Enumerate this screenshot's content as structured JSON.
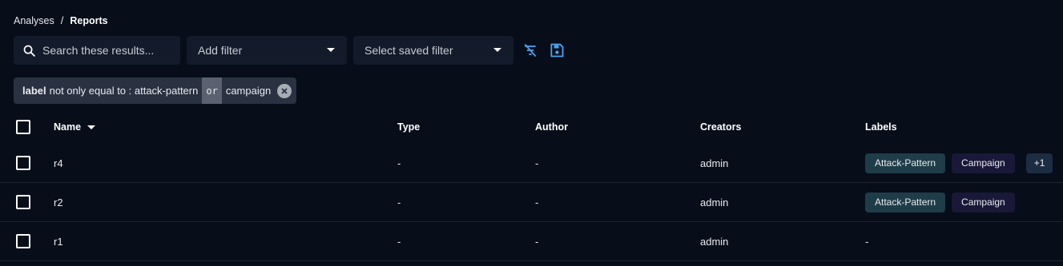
{
  "breadcrumb": {
    "parent": "Analyses",
    "separator": "/",
    "current": "Reports"
  },
  "toolbar": {
    "search_placeholder": "Search these results...",
    "add_filter": "Add filter",
    "saved_filter": "Select saved filter"
  },
  "active_filter": {
    "key": "label",
    "operator_and_value": "not only equal to : attack-pattern",
    "conjunction": "or",
    "value2": "campaign"
  },
  "table": {
    "columns": [
      "Name",
      "Type",
      "Author",
      "Creators",
      "Labels"
    ],
    "rows": [
      {
        "name": "r4",
        "type": "-",
        "author": "-",
        "creators": "admin",
        "labels": [
          "Attack-Pattern",
          "Campaign"
        ],
        "more": "+1"
      },
      {
        "name": "r2",
        "type": "-",
        "author": "-",
        "creators": "admin",
        "labels": [
          "Attack-Pattern",
          "Campaign"
        ]
      },
      {
        "name": "r1",
        "type": "-",
        "author": "-",
        "creators": "admin",
        "labels_text": "-"
      }
    ]
  },
  "colors": {
    "background": "#070d19",
    "accent": "#4aa3f0",
    "attack_label": "#1f3d48",
    "campaign_label": "#1a1838"
  }
}
